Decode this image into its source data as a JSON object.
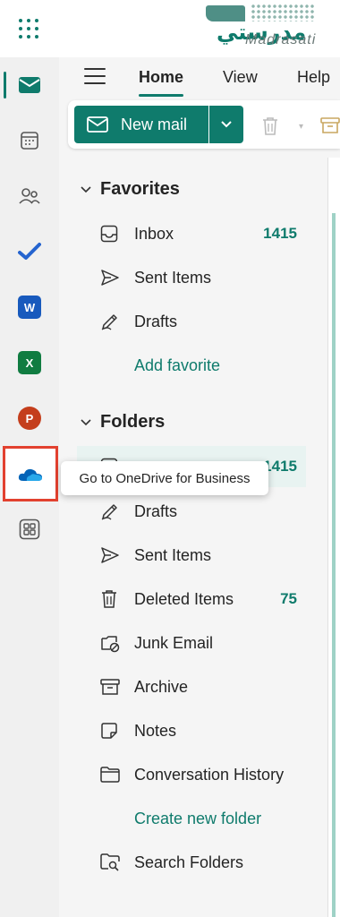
{
  "brand": {
    "logo_arabic": "مدرستي",
    "logo_latin": "Madrasati",
    "accent": "#0f7b6c"
  },
  "rail": {
    "items": [
      {
        "name": "mail",
        "icon": "mail-icon",
        "active": true
      },
      {
        "name": "calendar",
        "icon": "calendar-icon"
      },
      {
        "name": "people",
        "icon": "people-icon"
      },
      {
        "name": "todo",
        "icon": "todo-check-icon"
      },
      {
        "name": "word",
        "icon": "word-icon",
        "letter": "W"
      },
      {
        "name": "excel",
        "icon": "excel-icon",
        "letter": "X"
      },
      {
        "name": "powerpoint",
        "icon": "powerpoint-icon",
        "letter": "P"
      },
      {
        "name": "onedrive",
        "icon": "onedrive-icon",
        "highlighted": true
      },
      {
        "name": "more-apps",
        "icon": "apps-icon"
      }
    ]
  },
  "tooltip": "Go to OneDrive for Business",
  "tabs": {
    "home": "Home",
    "view": "View",
    "help": "Help"
  },
  "toolbar": {
    "new_mail": "New mail"
  },
  "favorites": {
    "title": "Favorites",
    "items": [
      {
        "label": "Inbox",
        "icon": "inbox-icon",
        "count": "1415"
      },
      {
        "label": "Sent Items",
        "icon": "send-icon",
        "count": ""
      },
      {
        "label": "Drafts",
        "icon": "drafts-icon",
        "count": ""
      }
    ],
    "add_link": "Add favorite"
  },
  "folders": {
    "title": "Folders",
    "inbox_count": "1415",
    "items": [
      {
        "label": "Drafts",
        "icon": "drafts-icon",
        "count": ""
      },
      {
        "label": "Sent Items",
        "icon": "send-icon",
        "count": ""
      },
      {
        "label": "Deleted Items",
        "icon": "trash-icon",
        "count": "75"
      },
      {
        "label": "Junk Email",
        "icon": "junk-icon",
        "count": ""
      },
      {
        "label": "Archive",
        "icon": "archive-icon",
        "count": ""
      },
      {
        "label": "Notes",
        "icon": "notes-icon",
        "count": ""
      },
      {
        "label": "Conversation History",
        "icon": "folder-icon",
        "count": ""
      }
    ],
    "create_link": "Create new folder",
    "search_folders": "Search Folders"
  }
}
